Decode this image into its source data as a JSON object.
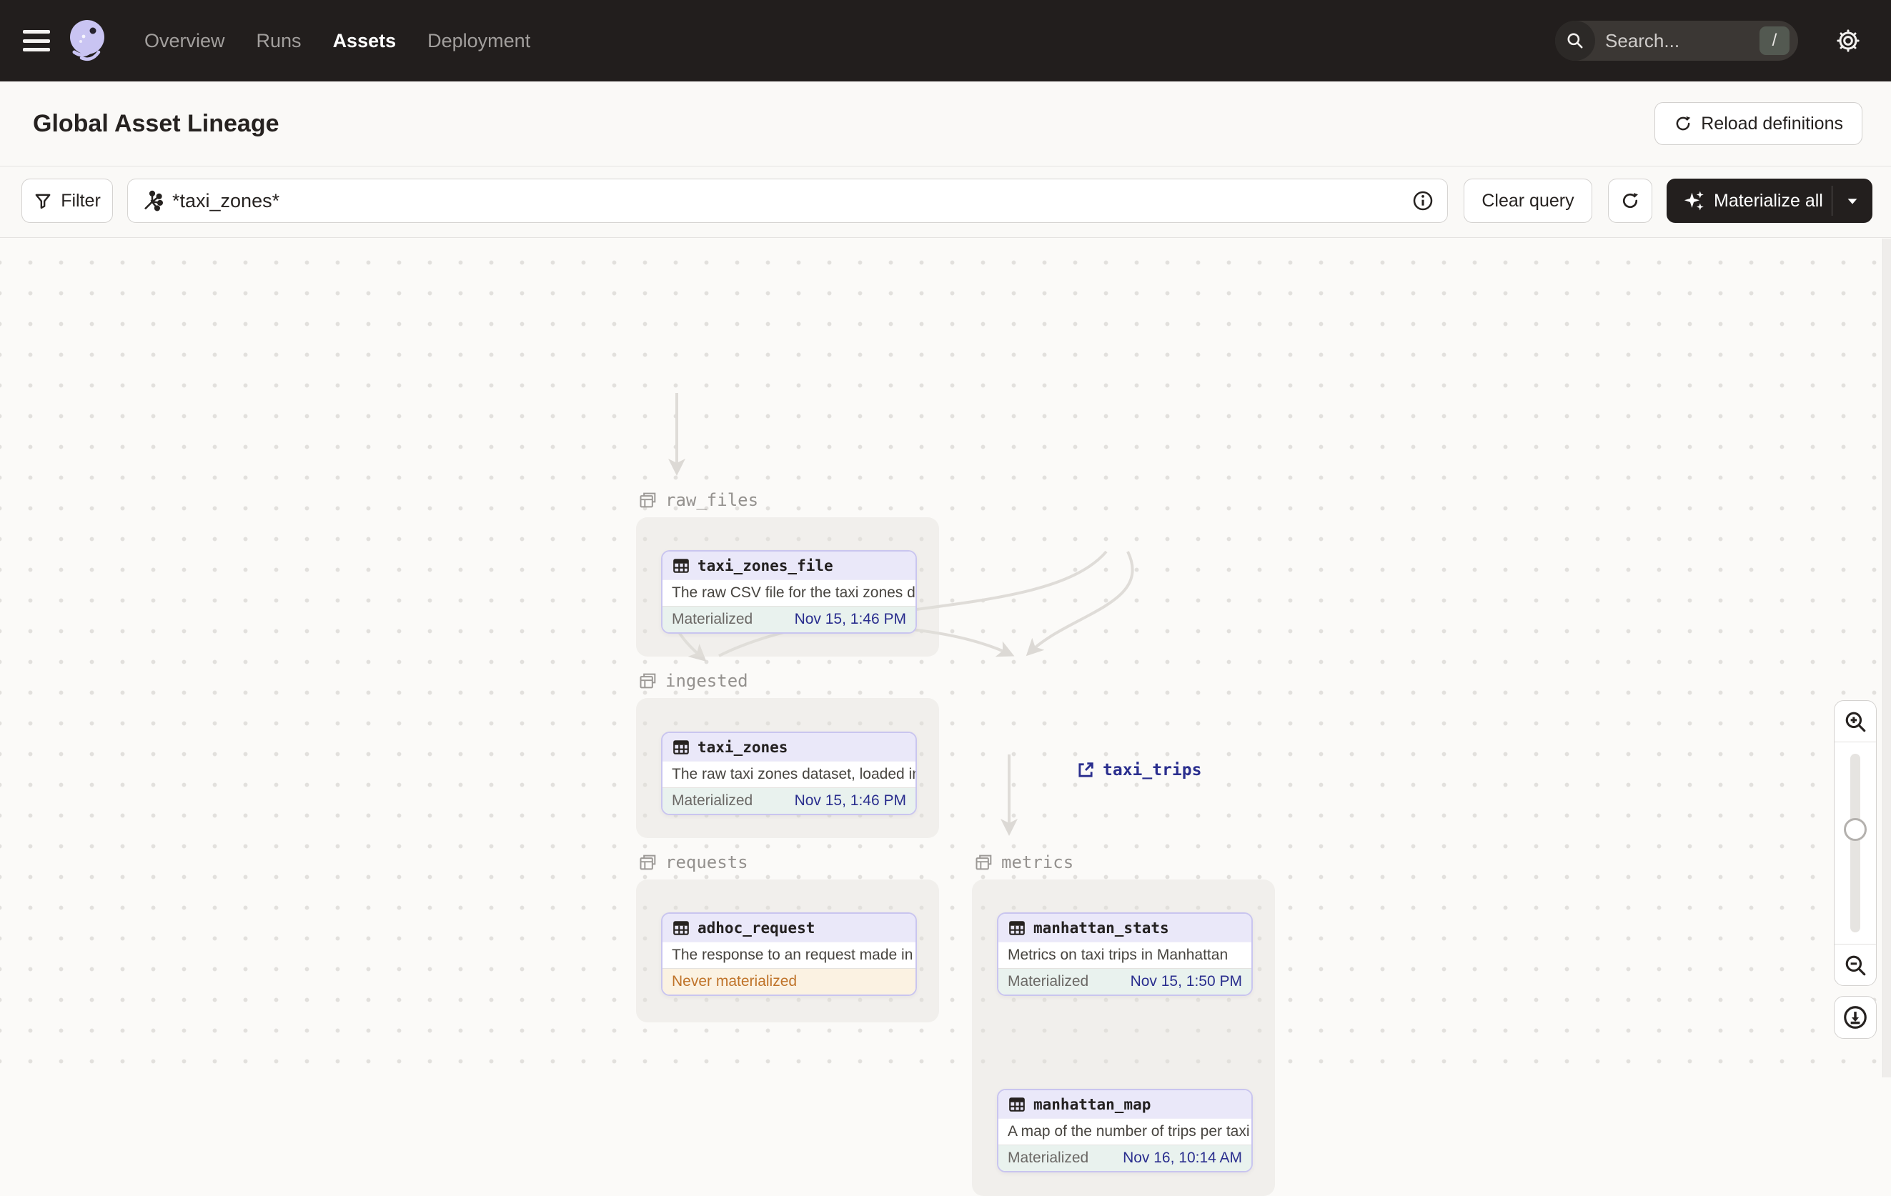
{
  "nav": {
    "items": [
      {
        "label": "Overview",
        "active": false
      },
      {
        "label": "Runs",
        "active": false
      },
      {
        "label": "Assets",
        "active": true
      },
      {
        "label": "Deployment",
        "active": false
      }
    ],
    "search": {
      "placeholder": "Search...",
      "shortcut": "/"
    }
  },
  "header": {
    "title": "Global Asset Lineage",
    "reload_button": "Reload definitions"
  },
  "toolbar": {
    "filter_button": "Filter",
    "query_value": "*taxi_zones*",
    "clear_query_button": "Clear query",
    "materialize_button": "Materialize all"
  },
  "graph": {
    "groups": [
      {
        "name": "raw_files"
      },
      {
        "name": "ingested"
      },
      {
        "name": "requests"
      },
      {
        "name": "metrics"
      }
    ],
    "nodes": [
      {
        "name": "taxi_zones_file",
        "description": "The raw CSV file for the taxi zones dat...",
        "status": "Materialized",
        "timestamp": "Nov 15, 1:46 PM"
      },
      {
        "name": "taxi_zones",
        "description": "The raw taxi zones dataset, loaded int...",
        "status": "Materialized",
        "timestamp": "Nov 15, 1:46 PM"
      },
      {
        "name": "adhoc_request",
        "description": "The response to an request made in th...",
        "status": "Never materialized",
        "timestamp": ""
      },
      {
        "name": "manhattan_stats",
        "description": "Metrics on taxi trips in Manhattan",
        "status": "Materialized",
        "timestamp": "Nov 15, 1:50 PM"
      },
      {
        "name": "manhattan_map",
        "description": "A map of the number of trips per taxi z...",
        "status": "Materialized",
        "timestamp": "Nov 16, 10:14 AM"
      }
    ],
    "external_assets": [
      {
        "name": "taxi_trips"
      }
    ]
  },
  "colors": {
    "nav_bg": "#221e1d",
    "accent_lavender": "#c9c5ef",
    "node_header_bg": "#eae8f9",
    "materialized_bg": "#e9f2ee",
    "materialized_time": "#2a2e8e",
    "never_materialized_bg": "#fbf2e2",
    "never_materialized_text": "#bf7329",
    "edge": "#dedbd8"
  }
}
